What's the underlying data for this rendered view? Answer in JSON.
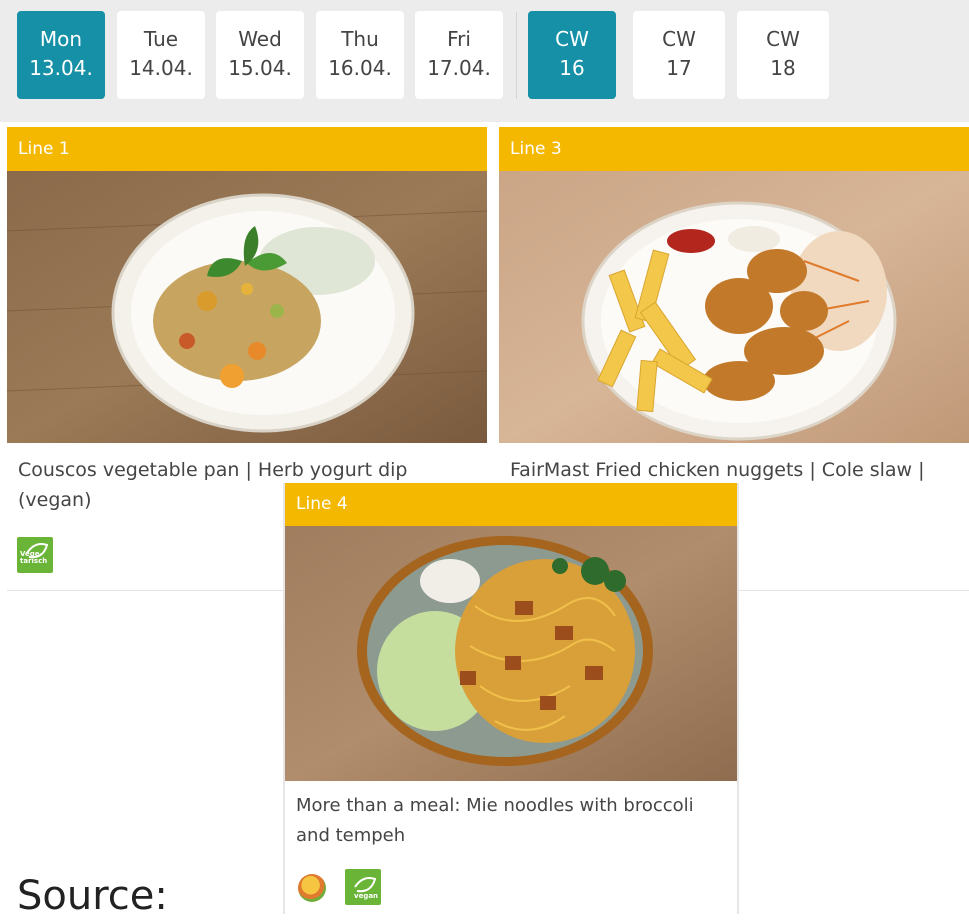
{
  "tabs": [
    {
      "l1": "Mon",
      "l2": "13.04."
    },
    {
      "l1": "Tue",
      "l2": "14.04."
    },
    {
      "l1": "Wed",
      "l2": "15.04."
    },
    {
      "l1": "Thu",
      "l2": "16.04."
    },
    {
      "l1": "Fri",
      "l2": "17.04."
    }
  ],
  "weeks": [
    {
      "l1": "CW",
      "l2": "16"
    },
    {
      "l1": "CW",
      "l2": "17"
    },
    {
      "l1": "CW",
      "l2": "18"
    }
  ],
  "card1": {
    "line": "Line 1",
    "title": "Couscos vegetable pan | Herb yogurt dip (vegan)",
    "badge": "Vege-tarisch"
  },
  "card3": {
    "line": "Line 3",
    "title": "FairMast Fried chicken nuggets | Cole slaw |"
  },
  "card4": {
    "line": "Line 4",
    "title": "More than a meal: Mie noodles with broccoli and tempeh",
    "badge": "vegan"
  },
  "caption": "Source:",
  "colors": {
    "accent": "#1590a6",
    "line_header": "#f5b800",
    "badge_green": "#6ab538"
  },
  "icons": [
    "vegetarian-badge-icon",
    "more-than-a-meal-icon",
    "vegan-badge-icon"
  ]
}
